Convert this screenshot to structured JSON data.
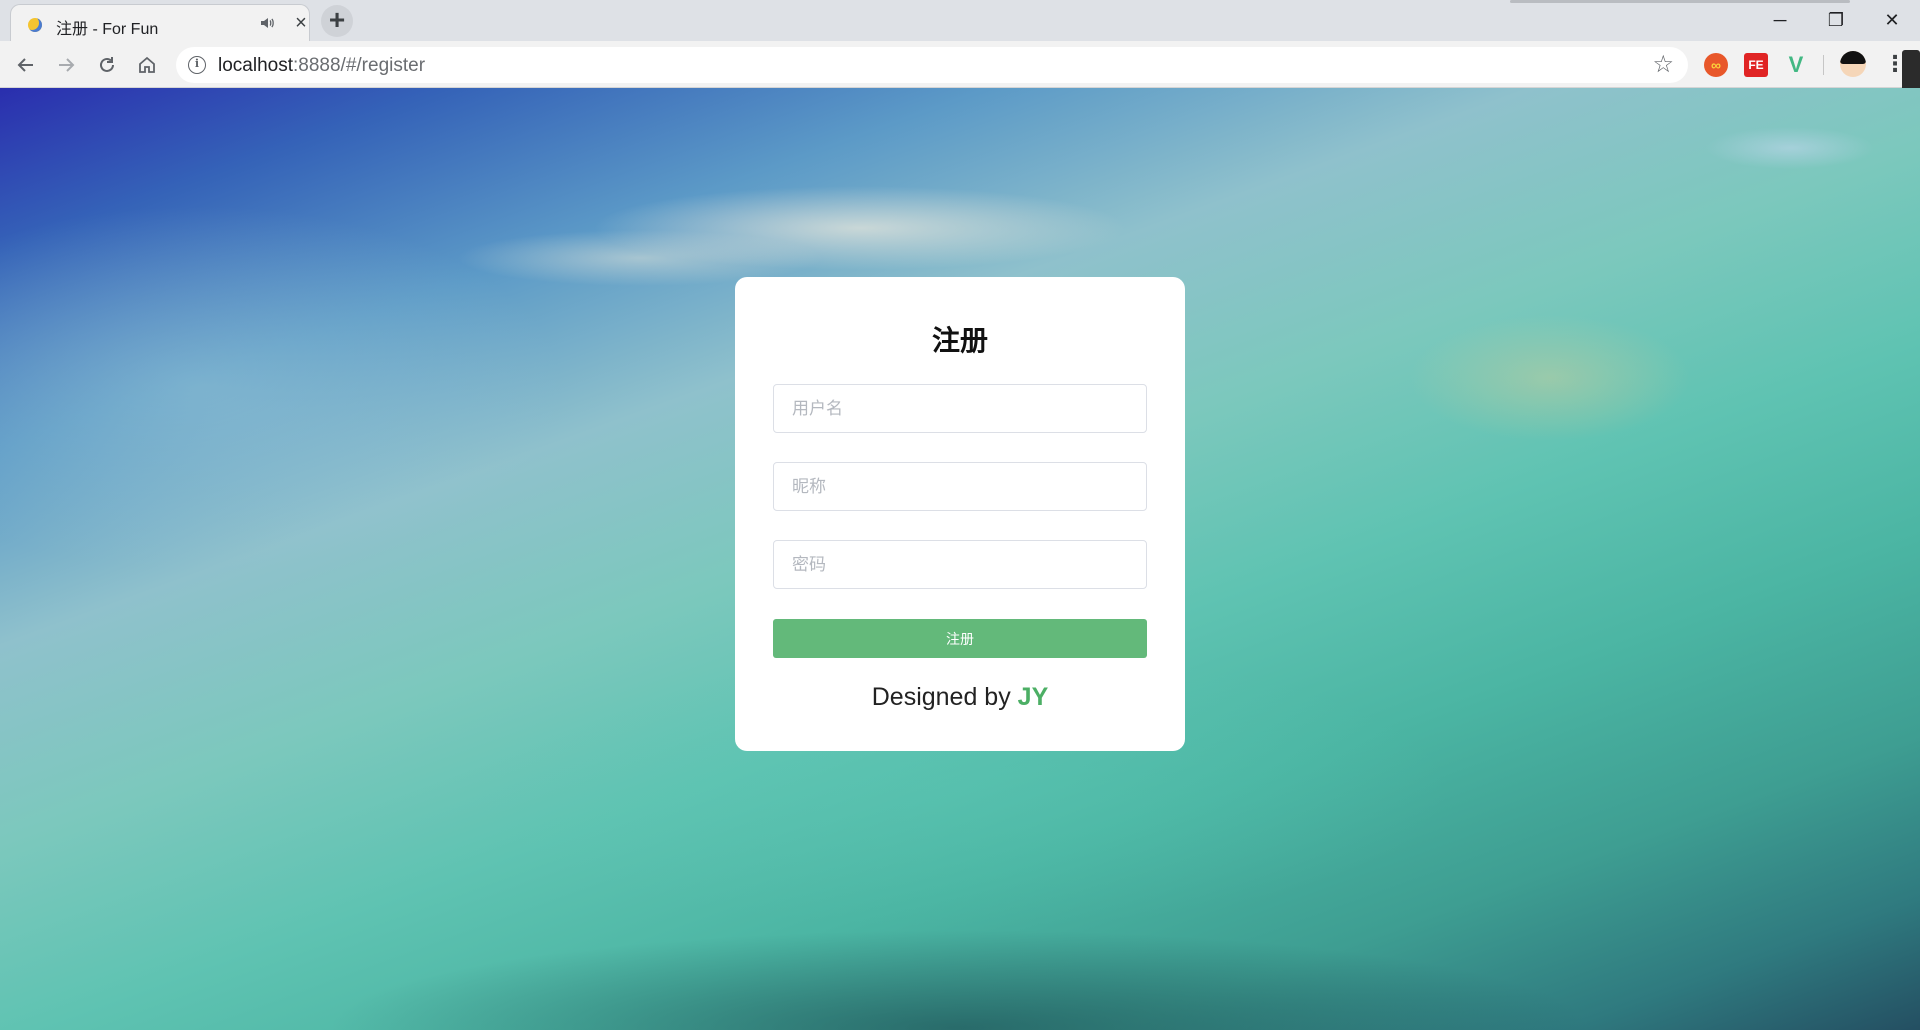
{
  "browser": {
    "tab": {
      "title": "注册 - For Fun",
      "close_label": "×"
    },
    "new_tab_label": "+",
    "window_controls": {
      "minimize": "─",
      "restore": "❐",
      "close": "✕"
    },
    "address_bar": {
      "url_host": "localhost",
      "url_rest": ":8888/#/register",
      "info_glyph": "i"
    },
    "extensions": [
      "infinity-extension",
      "fe-helper-extension",
      "vue-devtools-extension"
    ],
    "extension_labels": {
      "infinity": "∞",
      "fe": "FE",
      "vue": "V"
    }
  },
  "register_form": {
    "title": "注册",
    "username_placeholder": "用户名",
    "nickname_placeholder": "昵称",
    "password_placeholder": "密码",
    "submit_label": "注册",
    "credit_prefix": "Designed by ",
    "credit_author": "JY"
  },
  "colors": {
    "submit_button": "#63b97a",
    "author_accent": "#4caf65",
    "card_background": "#ffffff"
  }
}
